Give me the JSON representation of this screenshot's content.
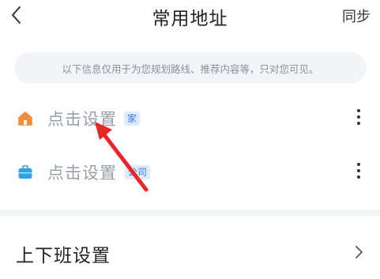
{
  "header": {
    "title": "常用地址",
    "sync_label": "同步",
    "back_icon": "chevron-left-icon"
  },
  "notice": {
    "text": "以下信息仅用于为您规划路线、推荐内容等，只对您可见。"
  },
  "addresses": [
    {
      "icon": "home-icon",
      "icon_color": "#f58a3a",
      "label": "点击设置",
      "tag": "家"
    },
    {
      "icon": "briefcase-icon",
      "icon_color": "#2ba3e6",
      "label": "点击设置",
      "tag": "公司"
    }
  ],
  "commute": {
    "label": "上下班设置",
    "icon": "chevron-right-icon"
  },
  "colors": {
    "tag_text": "#3a7be0",
    "tag_bg": "#dfeafb",
    "annotation_arrow": "#e8262a"
  }
}
